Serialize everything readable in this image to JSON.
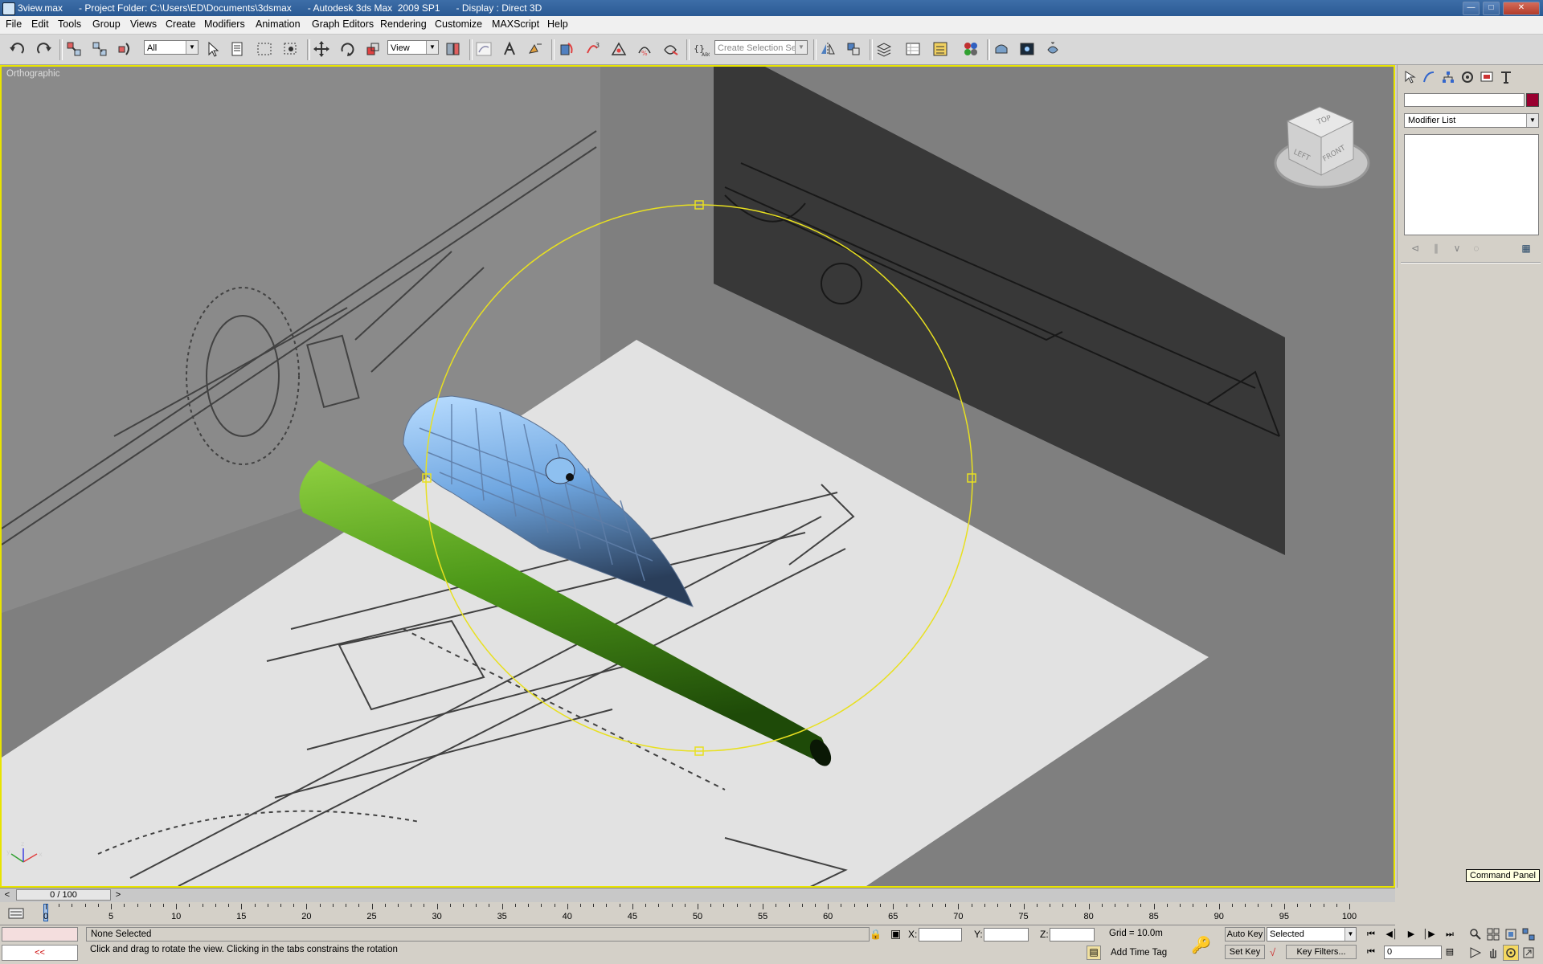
{
  "window": {
    "title": "3view.max      - Project Folder: C:\\Users\\ED\\Documents\\3dsmax      - Autodesk 3ds Max  2009 SP1      - Display : Direct 3D"
  },
  "menu": [
    "File",
    "Edit",
    "Tools",
    "Group",
    "Views",
    "Create",
    "Modifiers",
    "Animation",
    "Graph Editors",
    "Rendering",
    "Customize",
    "MAXScript",
    "Help"
  ],
  "toolbar": {
    "selection_filter": "All",
    "reference_coord": "View",
    "selection_set_placeholder": "Create Selection Set"
  },
  "viewport": {
    "label": "Orthographic",
    "viewcube_faces": {
      "top": "TOP",
      "left": "LEFT",
      "front": "FRONT"
    }
  },
  "command_panel": {
    "modifier_list": "Modifier List",
    "object_color": "#990030",
    "tooltip": "Command Panel"
  },
  "time": {
    "slider_label": "0 / 100",
    "tick_labels": [
      "0",
      "5",
      "10",
      "15",
      "20",
      "25",
      "30",
      "35",
      "40",
      "45",
      "50",
      "55",
      "60",
      "65",
      "70",
      "75",
      "80",
      "85",
      "90",
      "95",
      "100"
    ]
  },
  "status": {
    "selection": "None Selected",
    "prompt": "Click and drag to rotate the view.  Clicking in the tabs constrains the rotation",
    "x_label": "X:",
    "y_label": "Y:",
    "z_label": "Z:",
    "grid": "Grid = 10.0m",
    "add_time_tag": "Add Time Tag",
    "auto_key": "Auto Key",
    "set_key": "Set Key",
    "key_mode": "Selected",
    "key_filters": "Key Filters...",
    "current_frame": "0",
    "maxscript_listener": "<<"
  }
}
